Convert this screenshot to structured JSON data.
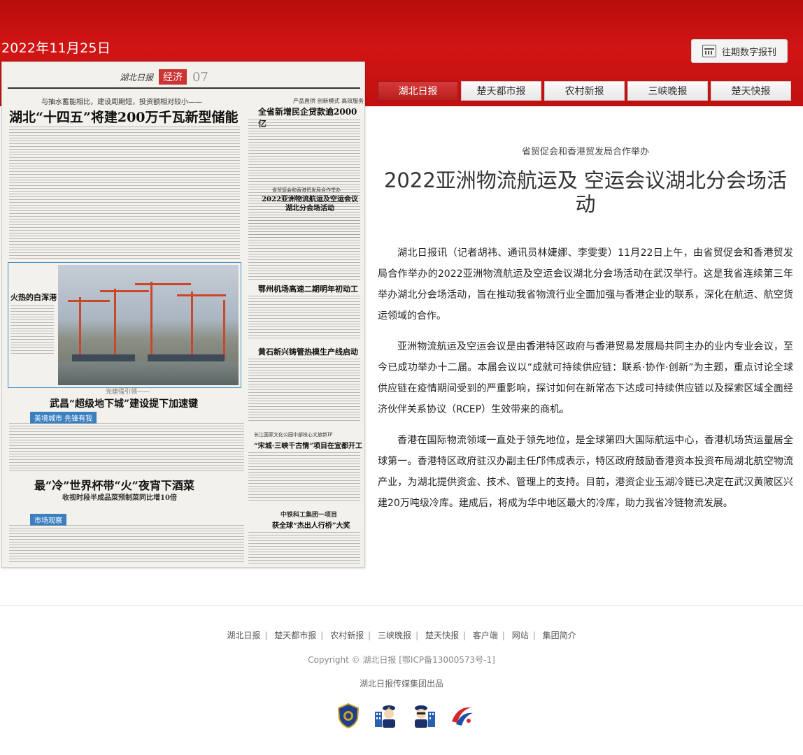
{
  "header": {
    "date": "2022年11月25日",
    "archive_label": "往期数字报刊"
  },
  "tabs": [
    {
      "label": "湖北日报",
      "active": true
    },
    {
      "label": "楚天都市报",
      "active": false
    },
    {
      "label": "农村新报",
      "active": false
    },
    {
      "label": "三峡晚报",
      "active": false
    },
    {
      "label": "楚天快报",
      "active": false
    }
  ],
  "paper": {
    "logo": "湖北日报",
    "section": "经济",
    "page_no": "07",
    "headlines": {
      "lead_sub": "与抽水蓄能相比，建设周期短，投资额相对较小——",
      "lead": "湖北“十四五”将建200万千瓦新型储能",
      "r1_sub": "产品直供 创新模式 高效服务",
      "r1": "全省新增民企贷款逾2000亿",
      "r2_sub": "省贸促会和香港贸发局合作举办",
      "r2": "2022亚洲物流航运及空运会议湖北分会场活动",
      "photo_caption": "火热的白浑港",
      "r3": "鄂州机场高速二期明年初动工",
      "r4": "黄石新兴铸管热模生产线启动",
      "mid_sub": "完建强引领——",
      "mid": "武昌“超级地下城”建设提下加速键",
      "tag1": "美境城市 先锋有我",
      "r5_sub": "长江国家文化公园中部核心文旅新IP",
      "r5": "“宋城·三峡千古情”项目在宜都开工",
      "bottom": "最“冷”世界杯带“火”夜宵下酒菜",
      "bottom_sub": "收视时段半成品菜预制菜同比增10倍",
      "tag2": "市场观察",
      "r6_sub": "中铁科工集团一项目",
      "r6": "获全球“杰出人行桥”大奖"
    }
  },
  "article": {
    "subtitle": "省贸促会和香港贸发局合作举办",
    "title": "2022亚洲物流航运及 空运会议湖北分会场活动",
    "paragraphs": [
      "湖北日报讯（记者胡祎、通讯员林婕娜、李雯雯）11月22日上午，由省贸促会和香港贸发局合作举办的2022亚洲物流航运及空运会议湖北分会场活动在武汉举行。这是我省连续第三年举办湖北分会场活动，旨在推动我省物流行业全面加强与香港企业的联系，深化在航运、航空货运领域的合作。",
      "亚洲物流航运及空运会议是由香港特区政府与香港贸易发展局共同主办的业内专业会议，至今已成功举办十二届。本届会议以“成就可持续供应链：联系·协作·创新”为主题，重点讨论全球供应链在疫情期间受到的严重影响，探讨如何在新常态下达成可持续供应链以及探索区域全面经济伙伴关系协议（RCEP）生效带来的商机。",
      "香港在国际物流领域一直处于领先地位，是全球第四大国际航运中心，香港机场货运量居全球第一。香港特区政府驻汉办副主任邝伟成表示，特区政府鼓励香港资本投资布局湖北航空物流产业，为湖北提供资金、技术、管理上的支持。目前，港资企业玉湖冷链已决定在武汉黄陂区兴建20万吨级冷库。建成后，将成为华中地区最大的冷库，助力我省冷链物流发展。"
    ]
  },
  "footer": {
    "links": [
      "湖北日报",
      "楚天都市报",
      "农村新报",
      "三峡晚报",
      "楚天快报",
      "客户端",
      "网站",
      "集团简介"
    ],
    "copyright": "Copyright © 湖北日报 [鄂ICP备13000573号-1]",
    "producer": "湖北日报传媒集团出品"
  }
}
